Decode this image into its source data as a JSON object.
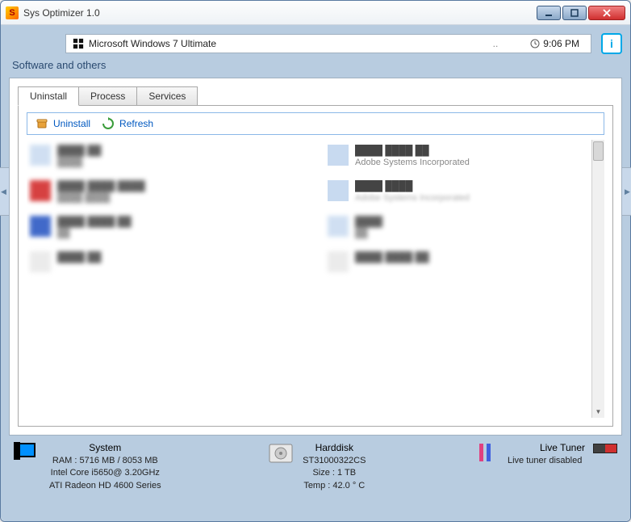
{
  "window": {
    "title": "Sys Optimizer 1.0"
  },
  "infobar": {
    "os": "Microsoft Windows 7 Ultimate",
    "separator": "..",
    "time": "9:06 PM"
  },
  "crumb": "Software and others",
  "tabs": {
    "t0": "Uninstall",
    "t1": "Process",
    "t2": "Services"
  },
  "toolbar": {
    "uninstall": "Uninstall",
    "refresh": "Refresh"
  },
  "apps": {
    "a1": {
      "name": "",
      "vendor": ""
    },
    "a2": {
      "name": "",
      "vendor": "Adobe Systems Incorporated"
    },
    "a3": {
      "name": "",
      "vendor": ""
    },
    "a4": {
      "name": "",
      "vendor": "Adobe Systems Incorporated"
    },
    "a5": {
      "name": "",
      "vendor": ""
    },
    "a6": {
      "name": "",
      "vendor": ""
    },
    "a7": {
      "name": "",
      "vendor": ""
    },
    "a8": {
      "name": "",
      "vendor": ""
    }
  },
  "status": {
    "system": {
      "title": "System",
      "ram": "RAM : 5716 MB / 8053 MB",
      "cpu": "Intel Core i5650@ 3.20GHz",
      "gpu": "ATI Radeon HD 4600 Series"
    },
    "hdd": {
      "title": "Harddisk",
      "model": "ST31000322CS",
      "size": "Size : 1 TB",
      "temp": "Temp : 42.0 ° C"
    },
    "live": {
      "title": "Live Tuner",
      "state": "Live tuner disabled"
    }
  }
}
